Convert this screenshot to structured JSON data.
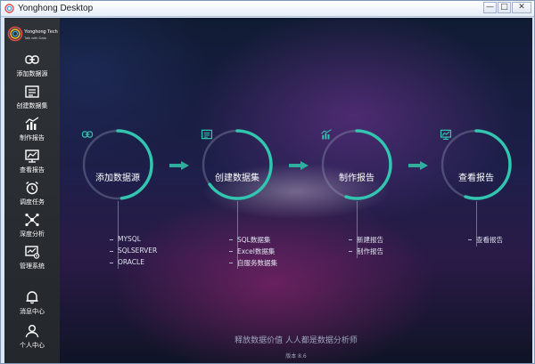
{
  "window": {
    "title": "Yonghong Desktop",
    "controls": {
      "minimize": "—",
      "maximize": "□",
      "close": "✕"
    }
  },
  "logo": {
    "name": "Yonghong Tech",
    "tagline": "Talk with Data"
  },
  "sidebar": {
    "items": [
      {
        "label": "添加数据源",
        "icon": "link-icon"
      },
      {
        "label": "创建数据集",
        "icon": "dataset-icon"
      },
      {
        "label": "制作报告",
        "icon": "report-chart-icon"
      },
      {
        "label": "查看报告",
        "icon": "view-report-icon"
      },
      {
        "label": "调度任务",
        "icon": "alarm-clock-icon"
      },
      {
        "label": "深度分析",
        "icon": "network-icon"
      },
      {
        "label": "管理系统",
        "icon": "admin-icon"
      }
    ],
    "bottom_items": [
      {
        "label": "消息中心",
        "icon": "bell-icon"
      },
      {
        "label": "个人中心",
        "icon": "user-icon"
      }
    ]
  },
  "steps": [
    {
      "label": "添加数据源",
      "icon": "link-icon",
      "progress": 0.48,
      "subitems": [
        "MYSQL",
        "SQLSERVER",
        "ORACLE"
      ]
    },
    {
      "label": "创建数据集",
      "icon": "dataset-icon",
      "progress": 0.65,
      "subitems": [
        "SQL数据集",
        "Excel数据集",
        "自服务数据集"
      ]
    },
    {
      "label": "制作报告",
      "icon": "report-chart-icon",
      "progress": 0.55,
      "subitems": [
        "新建报告",
        "制作报告"
      ]
    },
    {
      "label": "查看报告",
      "icon": "view-report-icon",
      "progress": 0.55,
      "subitems": [
        "查看报告"
      ]
    }
  ],
  "footer": {
    "slogan": "释放数据价值 人人都是数据分析师",
    "version": "版本 8.6"
  },
  "colors": {
    "accent": "#32c5b0",
    "sidebar_bg": "#2a2e33",
    "arrow": "#2fae9d"
  }
}
